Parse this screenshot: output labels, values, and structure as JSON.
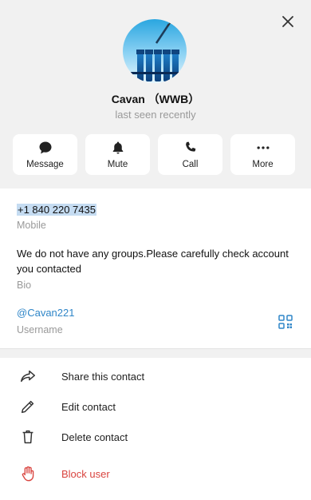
{
  "profile": {
    "name": "Cavan （WWB）",
    "status": "last seen recently"
  },
  "actions": [
    {
      "label": "Message",
      "icon": "message-icon"
    },
    {
      "label": "Mute",
      "icon": "bell-icon"
    },
    {
      "label": "Call",
      "icon": "phone-icon"
    },
    {
      "label": "More",
      "icon": "more-icon"
    }
  ],
  "info": {
    "phone": "+1 840 220 7435",
    "phone_label": "Mobile",
    "bio": "We do not have any groups.Please carefully check account you contacted",
    "bio_label": "Bio",
    "username": "@Cavan221",
    "username_label": "Username"
  },
  "menu": [
    {
      "label": "Share this contact",
      "icon": "share-icon"
    },
    {
      "label": "Edit contact",
      "icon": "pencil-icon"
    },
    {
      "label": "Delete contact",
      "icon": "trash-icon"
    },
    {
      "label": "Block user",
      "icon": "hand-icon"
    }
  ],
  "colors": {
    "accent": "#2f86c8",
    "danger": "#d9443f",
    "header_bg": "#f1f1f1"
  }
}
